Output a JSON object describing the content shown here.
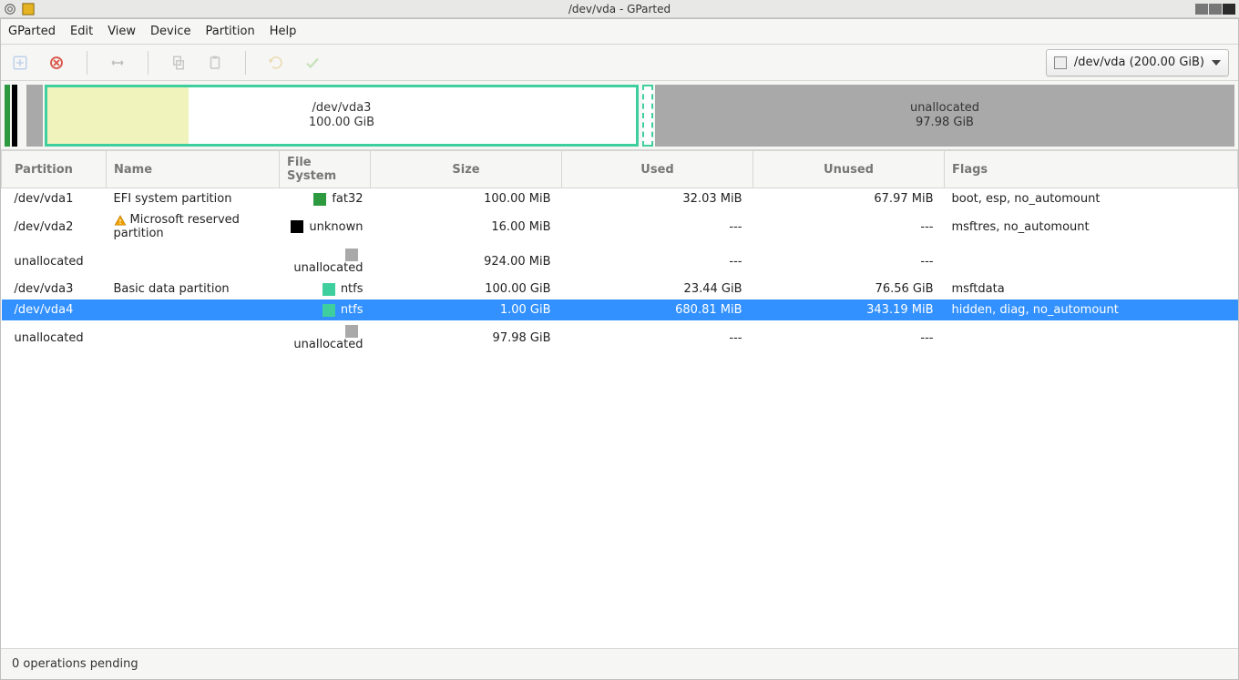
{
  "os": {
    "title": "/dev/vda - GParted"
  },
  "menu": {
    "items": [
      "GParted",
      "Edit",
      "View",
      "Device",
      "Partition",
      "Help"
    ]
  },
  "toolbar": {
    "device_label": "/dev/vda (200.00 GiB)"
  },
  "graph": {
    "vda3": {
      "name": "/dev/vda3",
      "size": "100.00 GiB"
    },
    "unalloc": {
      "name": "unallocated",
      "size": "97.98 GiB"
    }
  },
  "columns": {
    "partition": "Partition",
    "name": "Name",
    "fs": "File System",
    "size": "Size",
    "used": "Used",
    "unused": "Unused",
    "flags": "Flags"
  },
  "rows": [
    {
      "partition": "/dev/vda1",
      "warn": false,
      "name": "EFI system partition",
      "fs": "fat32",
      "sw": "sw-fat32",
      "size": "100.00 MiB",
      "used": "32.03 MiB",
      "unused": "67.97 MiB",
      "flags": "boot, esp, no_automount"
    },
    {
      "partition": "/dev/vda2",
      "warn": true,
      "name": "Microsoft reserved partition",
      "fs": "unknown",
      "sw": "sw-unknown",
      "size": "16.00 MiB",
      "used": "---",
      "unused": "---",
      "flags": "msftres, no_automount"
    },
    {
      "partition": "unallocated",
      "warn": false,
      "name": "",
      "fs": "unallocated",
      "sw": "sw-unalloc",
      "size": "924.00 MiB",
      "used": "---",
      "unused": "---",
      "flags": ""
    },
    {
      "partition": "/dev/vda3",
      "warn": false,
      "name": "Basic data partition",
      "fs": "ntfs",
      "sw": "sw-ntfs",
      "size": "100.00 GiB",
      "used": "23.44 GiB",
      "unused": "76.56 GiB",
      "flags": "msftdata"
    },
    {
      "partition": "/dev/vda4",
      "warn": false,
      "name": "",
      "fs": "ntfs",
      "sw": "sw-ntfs",
      "size": "1.00 GiB",
      "used": "680.81 MiB",
      "unused": "343.19 MiB",
      "flags": "hidden, diag, no_automount",
      "selected": true
    },
    {
      "partition": "unallocated",
      "warn": false,
      "name": "",
      "fs": "unallocated",
      "sw": "sw-unalloc",
      "size": "97.98 GiB",
      "used": "---",
      "unused": "---",
      "flags": ""
    }
  ],
  "status": {
    "pending": "0 operations pending"
  }
}
